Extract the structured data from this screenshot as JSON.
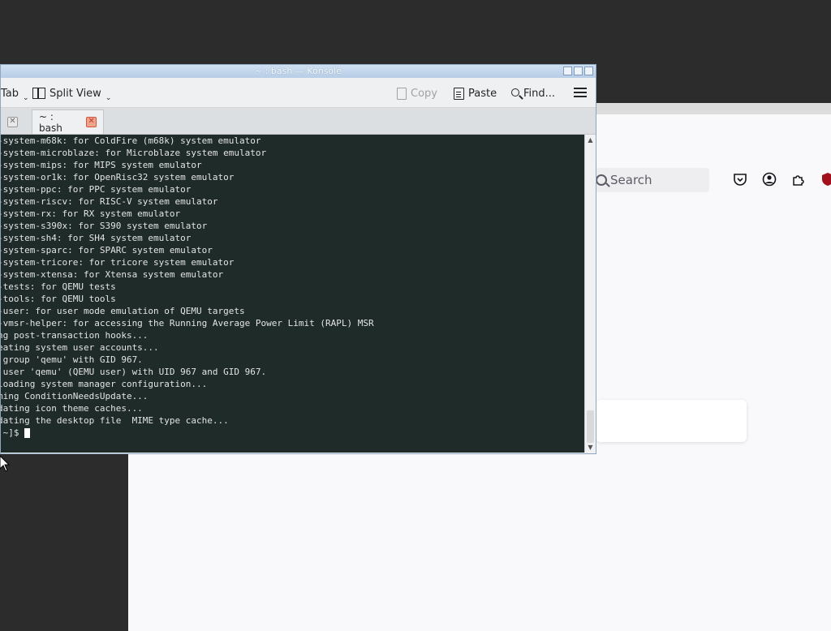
{
  "konsole": {
    "title": "~ : bash — Konsole",
    "toolbar": {
      "new_tab": "Tab",
      "split_view": "Split View",
      "copy": "Copy",
      "paste": "Paste",
      "find": "Find..."
    },
    "tabs": [
      {
        "label": "",
        "active": false
      },
      {
        "label": "~ : bash",
        "active": true
      }
    ],
    "terminal_lines": [
      "-system-m68k: for ColdFire (m68k) system emulator",
      "-system-microblaze: for Microblaze system emulator",
      "-system-mips: for MIPS system emulator",
      "-system-or1k: for OpenRisc32 system emulator",
      "-system-ppc: for PPC system emulator",
      "-system-riscv: for RISC-V system emulator",
      "-system-rx: for RX system emulator",
      "-system-s390x: for S390 system emulator",
      "-system-sh4: for SH4 system emulator",
      "-system-sparc: for SPARC system emulator",
      "-system-tricore: for tricore system emulator",
      "-system-xtensa: for Xtensa system emulator",
      "-tests: for QEMU tests",
      "-tools: for QEMU tools",
      "-user: for user mode emulation of QEMU targets",
      "-vmsr-helper: for accessing the Running Average Power Limit (RAPL) MSR",
      "ng post-transaction hooks...",
      "eating system user accounts...",
      " group 'qemu' with GID 967.",
      " user 'qemu' (QEMU user) with UID 967 and GID 967.",
      "loading system manager configuration...",
      "ming ConditionNeedsUpdate...",
      "dating icon theme caches...",
      "dating the desktop file  MIME type cache..."
    ],
    "prompt": " ~]$ "
  },
  "browser": {
    "search_placeholder": "Search"
  },
  "icons": {
    "pocket": "pocket-icon",
    "account": "account-icon",
    "extensions": "extensions-icon",
    "ublock": "ublock-icon"
  },
  "colors": {
    "terminal_bg": "#1e2b29",
    "terminal_fg": "#e4e4e4",
    "titlebar": "#b7cde6",
    "desktop": "#2c2c2c"
  }
}
